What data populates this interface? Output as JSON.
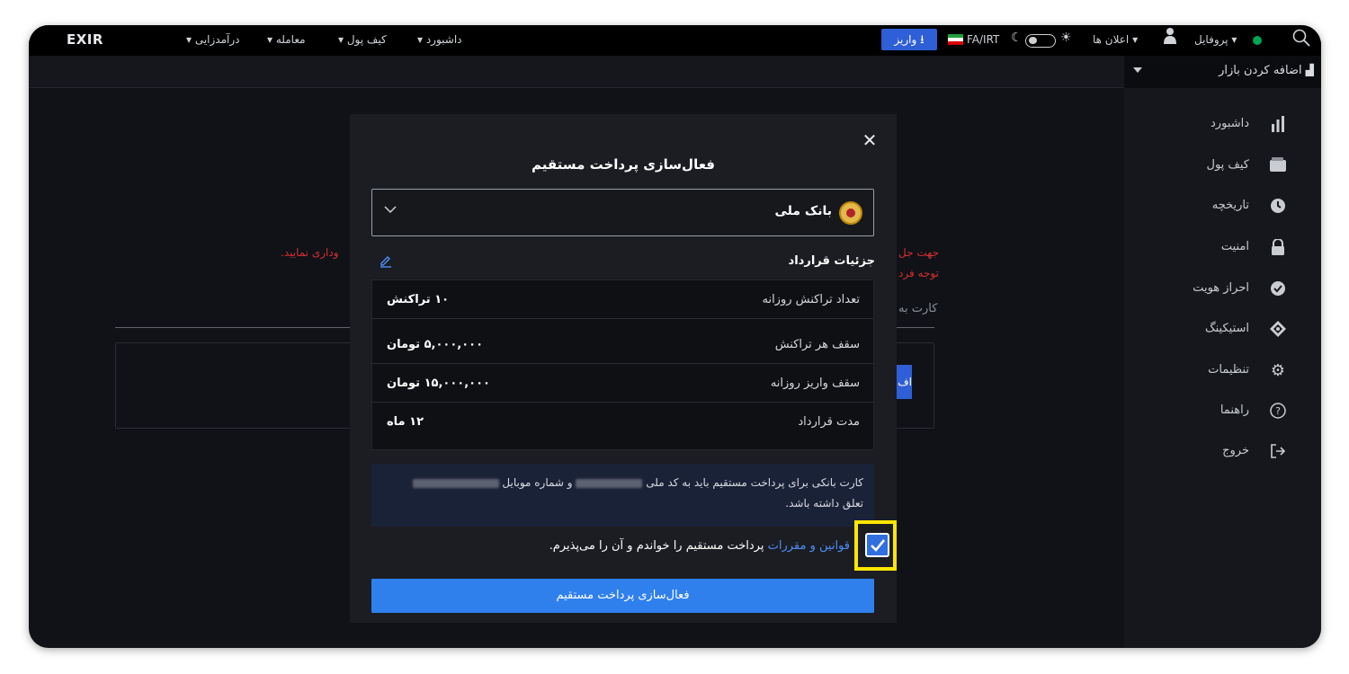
{
  "header": {
    "logo": "EXIR",
    "nav": [
      "درآمدزایی ▾",
      "معامله ▾",
      "کیف پول ▾",
      "داشبورد ▾"
    ],
    "deposit_label": "واریز",
    "currency_label": "FA/IRT",
    "announcements_label": "▾ اعلان ها",
    "profile_label": "▾ پروفایل"
  },
  "market": {
    "add_label": "اضافه کردن بازار"
  },
  "sidebar": {
    "items": [
      {
        "label": "داشبورد",
        "icon": "bar-chart-icon"
      },
      {
        "label": "کیف پول",
        "icon": "wallet-icon"
      },
      {
        "label": "تاریخچه",
        "icon": "clock-icon"
      },
      {
        "label": "امنیت",
        "icon": "lock-icon"
      },
      {
        "label": "احراز هویت",
        "icon": "verified-icon"
      },
      {
        "label": "استیکینگ",
        "icon": "staking-icon"
      },
      {
        "label": "تنظیمات",
        "icon": "gear-icon"
      },
      {
        "label": "راهنما",
        "icon": "help-icon"
      },
      {
        "label": "خروج",
        "icon": "logout-icon"
      }
    ]
  },
  "background": {
    "red_line1_right": "جهت جل",
    "red_line1_left": "وداری نمایید.",
    "red_line2": "توجه فرد",
    "gray_text": "کارت به",
    "btn_char": "اف"
  },
  "modal": {
    "title": "فعال‌سازی پرداخت مستقیم",
    "bank_name": "بانک ملی",
    "details_title": "جزئیات قرارداد",
    "details": [
      {
        "key": "تعداد تراکنش روزانه",
        "value": "۱۰ تراکنش"
      },
      {
        "key": "سقف هر تراکنش",
        "value": "۵,۰۰۰,۰۰۰ تومان"
      },
      {
        "key": "سقف واریز روزانه",
        "value": "۱۵,۰۰۰,۰۰۰ تومان"
      },
      {
        "key": "مدت قرارداد",
        "value": "۱۲ ماه"
      }
    ],
    "note_part1": "کارت بانکی برای پرداخت مستقیم باید به کد ملی",
    "note_part2": "و شماره موبایل",
    "note_line2": "تعلق داشته باشد.",
    "terms_link": "قوانین و مقررات",
    "terms_text": "پرداخت مستقیم را خواندم و آن را می‌پذیرم.",
    "terms_checked": true,
    "submit_label": "فعال‌سازی پرداخت مستقیم"
  },
  "colors": {
    "accent": "#2f80ed",
    "highlight": "#ffe600",
    "error": "#d23030",
    "online": "#00a651"
  }
}
